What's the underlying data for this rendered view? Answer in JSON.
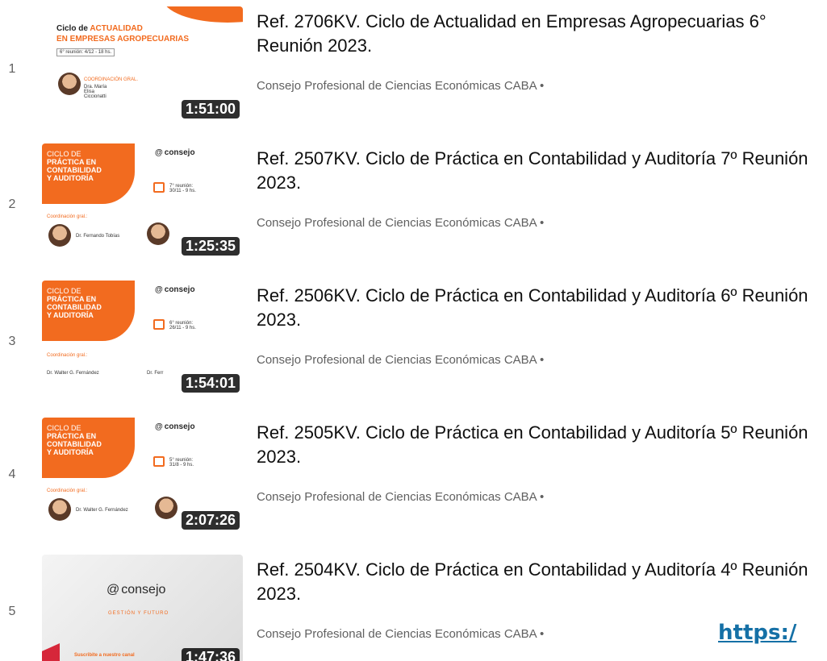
{
  "videos": [
    {
      "index": "1",
      "title": "Ref. 2706KV. Ciclo de Actualidad en Empresas Agropecuarias 6° Reunión 2023.",
      "channel": "Consejo Profesional de Ciencias Económicas CABA •",
      "duration": "1:51:00",
      "thumb": {
        "line1": "Ciclo de ",
        "line1b": "ACTUALIDAD",
        "line2": "EN EMPRESAS AGROPECUARIAS",
        "meeting": "6° reunión: 4/12 - 18 hs.",
        "coord": "COORDINACIÓN GRAL.",
        "person": "Dra. María Elisa Ciccionatti"
      }
    },
    {
      "index": "2",
      "title": "Ref. 2507KV. Ciclo de Práctica en Contabilidad y Auditoría 7º Reunión 2023.",
      "channel": "Consejo Profesional de Ciencias Económicas CABA •",
      "duration": "1:25:35",
      "thumb": {
        "line1": "CICLO DE",
        "line2": "PRÁCTICA EN",
        "line3": "CONTABILIDAD",
        "line4": "Y AUDITORÍA",
        "logo": "consejo",
        "meeting": "7° reunión: 30/11 - 9 hs.",
        "coord": "Coordinación gral.:",
        "person": "Dr. Fernando Tobías"
      }
    },
    {
      "index": "3",
      "title": "Ref. 2506KV. Ciclo de Práctica en Contabilidad y Auditoría 6º Reunión 2023.",
      "channel": "Consejo Profesional de Ciencias Económicas CABA •",
      "duration": "1:54:01",
      "thumb": {
        "line1": "CICLO DE",
        "line2": "PRÁCTICA EN",
        "line3": "CONTABILIDAD",
        "line4": "Y AUDITORÍA",
        "logo": "consejo",
        "meeting": "6° reunión: 26/11 - 9 hs.",
        "coord": "Coordinación gral.:",
        "person": "Dr. Walter G. Fernández",
        "person2": "Dr. Ferr"
      }
    },
    {
      "index": "4",
      "title": "Ref. 2505KV. Ciclo de Práctica en Contabilidad y Auditoría 5º Reunión 2023.",
      "channel": "Consejo Profesional de Ciencias Económicas CABA •",
      "duration": "2:07:26",
      "thumb": {
        "line1": "CICLO DE",
        "line2": "PRÁCTICA EN",
        "line3": "CONTABILIDAD",
        "line4": "Y AUDITORÍA",
        "logo": "consejo",
        "meeting": "5° reunión: 31/8 - 9 hs.",
        "coord": "Coordinación gral.:",
        "person": "Dr. Walter G. Fernández"
      }
    },
    {
      "index": "5",
      "title": "Ref. 2504KV. Ciclo de Práctica en Contabilidad y Auditoría 4º Reunión 2023.",
      "channel": "Consejo Profesional de Ciencias Económicas CABA •",
      "duration": "1:47:36",
      "thumb": {
        "logo": "consejo",
        "tagline": "GESTIÓN Y FUTURO",
        "subscribe": "Suscribite a nuestro canal"
      }
    }
  ],
  "link_fragment": "https:/",
  "colors": {
    "accent": "#f26b1f",
    "link": "#1570a6",
    "meta": "#606060"
  }
}
